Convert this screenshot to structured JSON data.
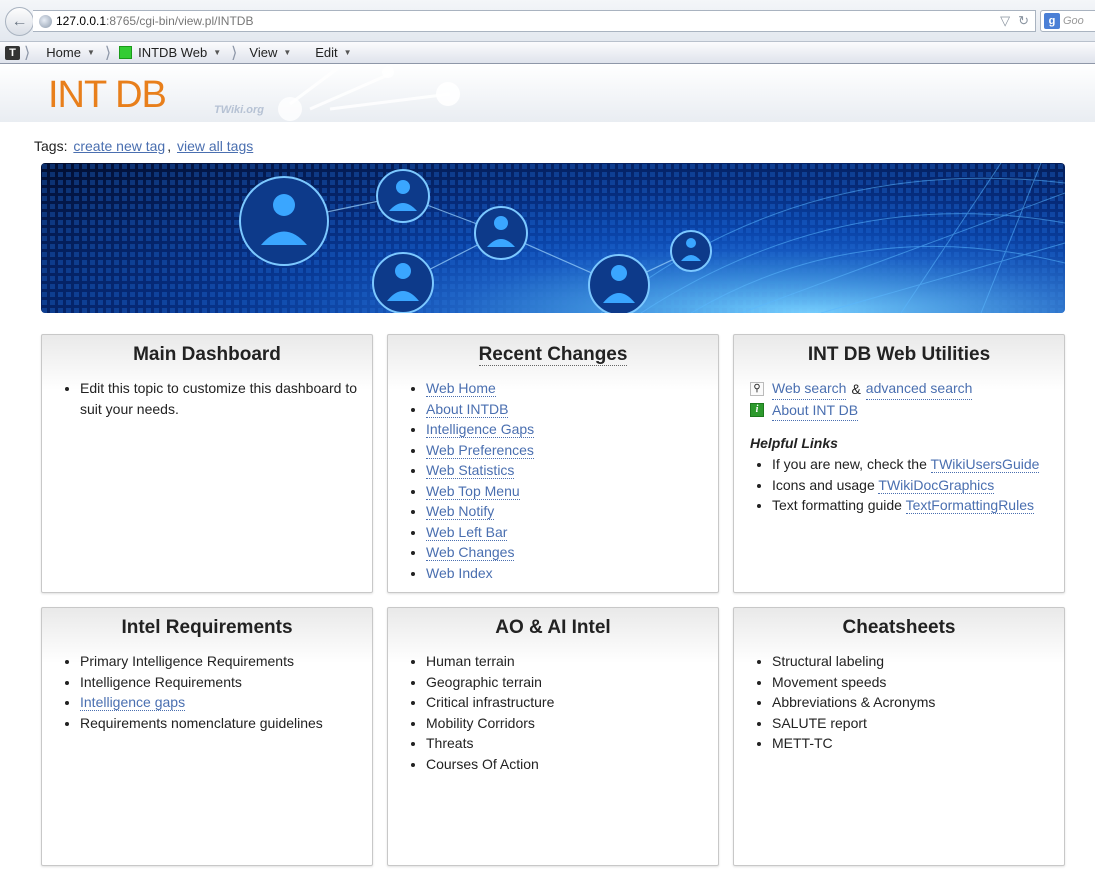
{
  "browser": {
    "url_host": "127.0.0.1",
    "url_path": ":8765/cgi-bin/view.pl/INTDB",
    "search_placeholder": "Goo"
  },
  "menubar": {
    "items": [
      {
        "label": "Home"
      },
      {
        "label": "INTDB Web"
      },
      {
        "label": "View"
      },
      {
        "label": "Edit"
      }
    ]
  },
  "header": {
    "title": "INT DB",
    "subtitle": "TWiki.org"
  },
  "tags": {
    "label": "Tags:",
    "create": "create new tag",
    "separator": ",",
    "view_all": "view all tags"
  },
  "cards": {
    "dashboard": {
      "title": "Main Dashboard",
      "items": [
        "Edit this topic to customize this dashboard to suit your needs."
      ]
    },
    "recent": {
      "title": "Recent Changes",
      "items": [
        "Web Home",
        "About INTDB",
        "Intelligence Gaps",
        "Web Preferences",
        "Web Statistics",
        "Web Top Menu",
        "Web Notify",
        "Web Left Bar",
        "Web Changes",
        "Web Index"
      ]
    },
    "utilities": {
      "title": "INT DB Web Utilities",
      "search": "Web search",
      "amp": "&",
      "advanced": "advanced search",
      "about": "About INT DB",
      "helpful_title": "Helpful Links",
      "helpful": [
        {
          "text": "If you are new, check the",
          "link": "TWikiUsersGuide"
        },
        {
          "text": "Icons and usage",
          "link": "TWikiDocGraphics"
        },
        {
          "text": "Text formatting guide",
          "link": "TextFormattingRules"
        }
      ]
    },
    "requirements": {
      "title": "Intel Requirements",
      "items": [
        "Primary Intelligence Requirements",
        "Intelligence Requirements",
        "Intelligence gaps",
        "Requirements nomenclature guidelines"
      ]
    },
    "ao": {
      "title": "AO & AI Intel",
      "items": [
        "Human terrain",
        "Geographic terrain",
        "Critical infrastructure",
        "Mobility Corridors",
        "Threats",
        "Courses Of Action"
      ]
    },
    "cheatsheets": {
      "title": "Cheatsheets",
      "items": [
        "Structural labeling",
        "Movement speeds",
        "Abbreviations & Acronyms",
        "SALUTE report",
        "METT-TC"
      ]
    }
  }
}
